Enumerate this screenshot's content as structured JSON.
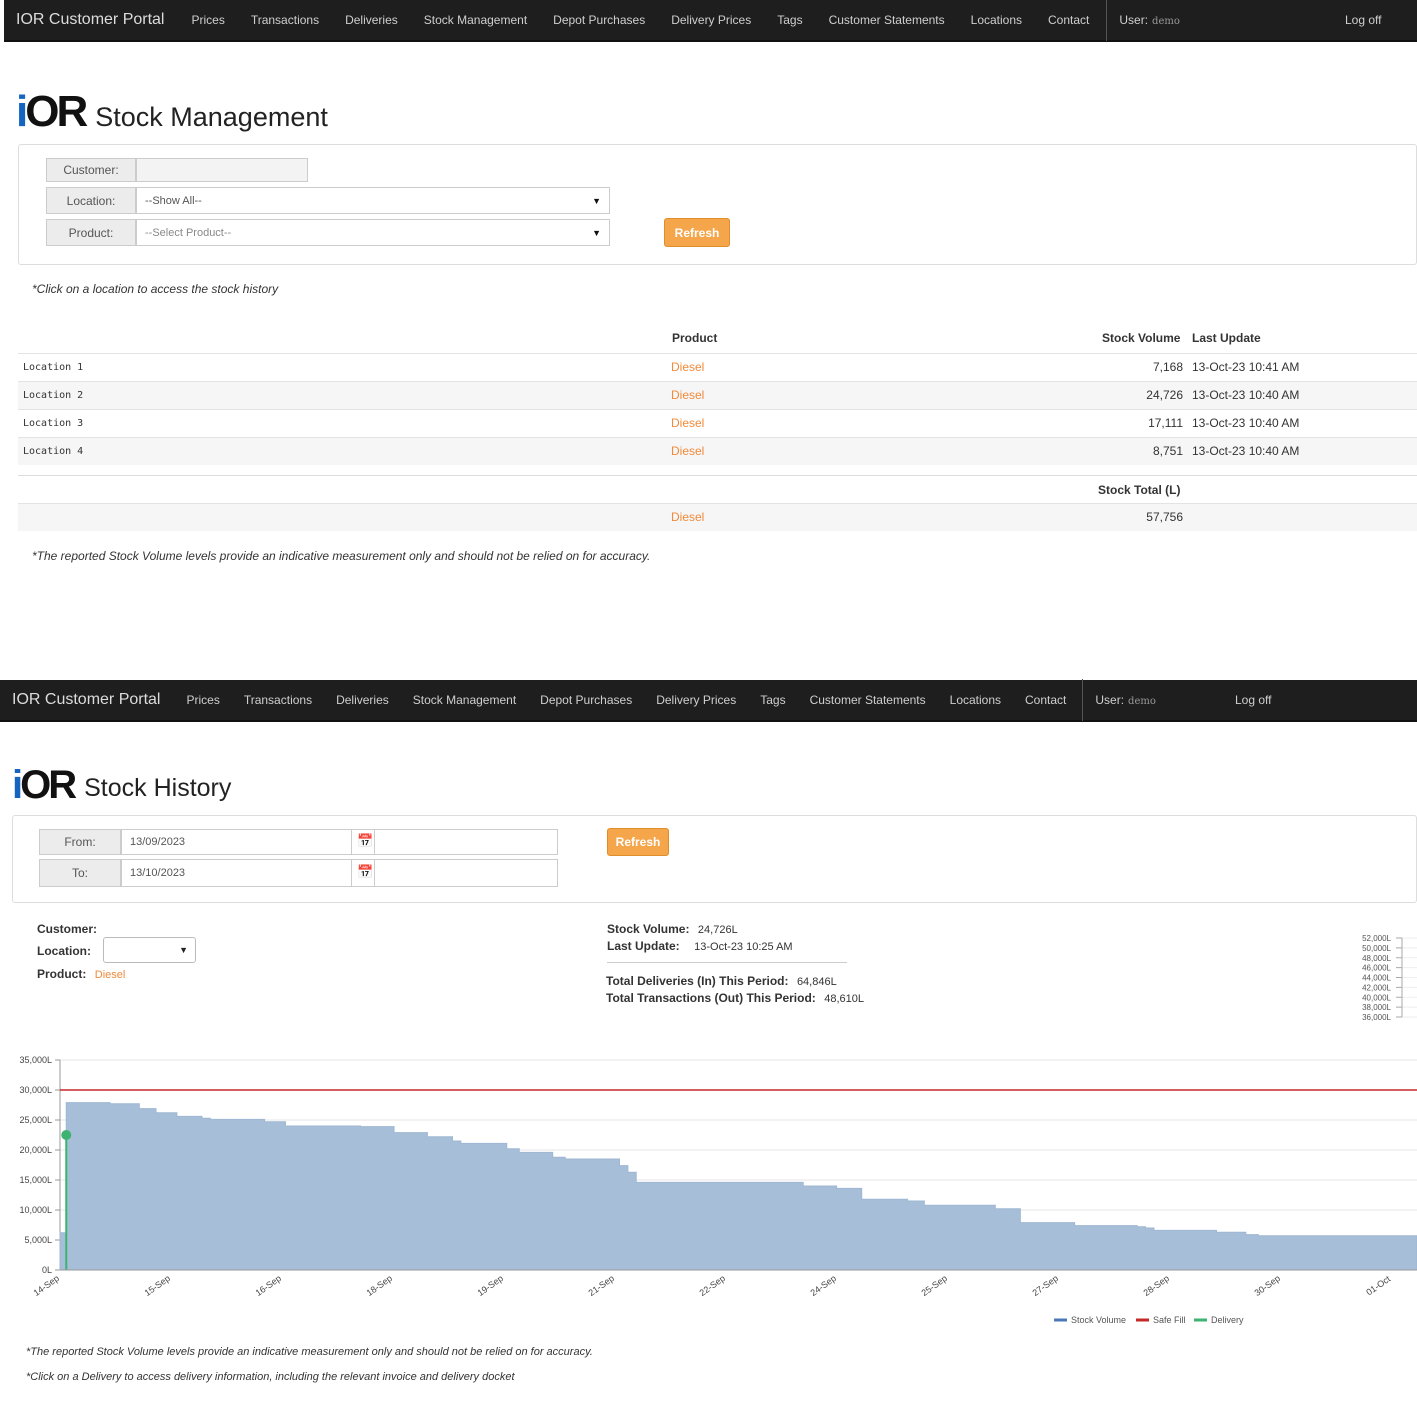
{
  "nav": {
    "brand": "IOR Customer Portal",
    "items": [
      "Prices",
      "Transactions",
      "Deliveries",
      "Stock Management",
      "Depot Purchases",
      "Delivery Prices",
      "Tags",
      "Customer Statements",
      "Locations",
      "Contact"
    ],
    "user_label": "User:",
    "user_name": "demo",
    "logoff": "Log off"
  },
  "logo": {
    "dot": "i",
    "rest": "OR"
  },
  "stock_management": {
    "title": "Stock Management",
    "filters": {
      "customer_label": "Customer:",
      "customer_value": "",
      "location_label": "Location:",
      "location_value": "--Show All--",
      "product_label": "Product:",
      "product_placeholder": "--Select Product--",
      "refresh": "Refresh"
    },
    "note_top": "*Click on a location to access the stock history",
    "columns": {
      "product": "Product",
      "volume": "Stock Volume",
      "update": "Last Update"
    },
    "rows": [
      {
        "location": "Location 1",
        "product": "Diesel",
        "volume": "7,168",
        "update": "13-Oct-23 10:41 AM"
      },
      {
        "location": "Location 2",
        "product": "Diesel",
        "volume": "24,726",
        "update": "13-Oct-23 10:40 AM"
      },
      {
        "location": "Location 3",
        "product": "Diesel",
        "volume": "17,111",
        "update": "13-Oct-23 10:40 AM"
      },
      {
        "location": "Location 4",
        "product": "Diesel",
        "volume": "8,751",
        "update": "13-Oct-23 10:40 AM"
      }
    ],
    "total_label": "Stock Total (L)",
    "total_product": "Diesel",
    "total_value": "57,756",
    "disclaimer": "*The reported Stock Volume levels provide an indicative measurement only and should not be relied on for accuracy."
  },
  "stock_history": {
    "title": "Stock History",
    "from_label": "From:",
    "from_value": "13/09/2023",
    "to_label": "To:",
    "to_value": "13/10/2023",
    "refresh": "Refresh",
    "customer_label": "Customer:",
    "location_label": "Location:",
    "product_label": "Product:",
    "product_value": "Diesel",
    "stock_volume_label": "Stock Volume:",
    "stock_volume_value": "24,726L",
    "last_update_label": "Last Update:",
    "last_update_value": "13-Oct-23 10:25 AM",
    "deliveries_label": "Total Deliveries (In) This Period:",
    "deliveries_value": "64,846L",
    "transactions_label": "Total Transactions (Out) This Period:",
    "transactions_value": "48,610L",
    "disclaimer": "*The reported Stock Volume levels provide an indicative measurement only and should not be relied on for accuracy.",
    "delivery_note": "*Click on a Delivery to access delivery information, including the relevant invoice and delivery docket"
  },
  "colors": {
    "accent": "#f5a54a",
    "link": "#f08a3a",
    "navbar": "#1e1e1e",
    "area": "#a7bed8",
    "safe_fill": "#c62828",
    "delivery": "#3cb371"
  },
  "chart_data": [
    {
      "type": "area",
      "y_ticks": [
        "0L",
        "5,000L",
        "10,000L",
        "15,000L",
        "20,000L",
        "25,000L",
        "30,000L",
        "35,000L"
      ],
      "x_ticks": [
        "14-Sep",
        "15-Sep",
        "16-Sep",
        "18-Sep",
        "19-Sep",
        "21-Sep",
        "22-Sep",
        "24-Sep",
        "25-Sep",
        "27-Sep",
        "28-Sep",
        "30-Sep",
        "01-Oct"
      ],
      "ylim": [
        0,
        35000
      ],
      "x": [
        0,
        0.15,
        0.15,
        1.2,
        1.9,
        2.3,
        2.8,
        3.4,
        3.6,
        4.9,
        5.4,
        6.8,
        7.2,
        8.0,
        8.8,
        9.4,
        9.6,
        10.7,
        11.0,
        11.8,
        12.1,
        13.4,
        13.6,
        13.8,
        15.1,
        16.7,
        17.3,
        17.8,
        18.6,
        19.2,
        20.3,
        20.7,
        22.4,
        23.0,
        24.3,
        25.8,
        26.0,
        26.2,
        27.7,
        28.4,
        28.7,
        29.7,
        30.0
      ],
      "x_note_units": "days after 14-Sep",
      "series": [
        {
          "name": "Stock Volume",
          "values": [
            6200,
            6200,
            27900,
            27700,
            26900,
            26200,
            25600,
            25300,
            25100,
            24700,
            24000,
            24000,
            23900,
            22900,
            22200,
            21500,
            21100,
            20200,
            19600,
            18800,
            18500,
            17400,
            16300,
            14600,
            14600,
            14600,
            14600,
            14000,
            13600,
            11800,
            11500,
            10800,
            10200,
            7900,
            7400,
            7200,
            7000,
            6600,
            6300,
            5900,
            5700,
            5700,
            5700
          ]
        },
        {
          "name": "Safe Fill",
          "values": [
            30000
          ]
        },
        {
          "name": "Delivery",
          "values": [
            22500
          ]
        }
      ],
      "delivery_x": 0.15,
      "legend": "bottom-right"
    },
    {
      "type": "line",
      "y_ticks": [
        "52,000L",
        "50,000L",
        "48,000L",
        "46,000L",
        "44,000L",
        "42,000L",
        "40,000L",
        "38,000L",
        "36,000L"
      ],
      "ylim": [
        36000,
        52000
      ]
    }
  ]
}
